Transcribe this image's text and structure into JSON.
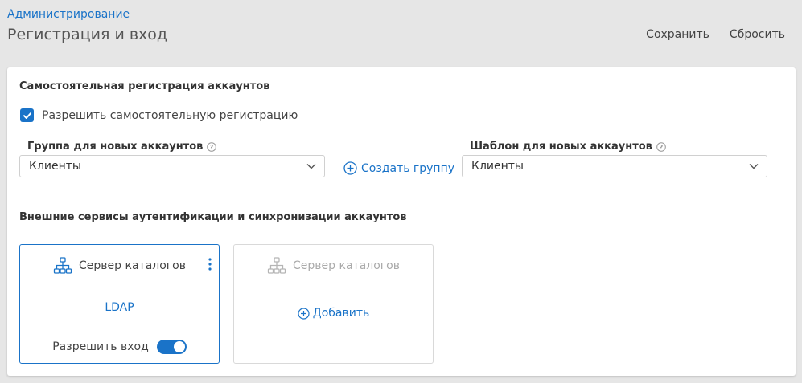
{
  "header": {
    "breadcrumb": "Администрирование",
    "title": "Регистрация и вход",
    "save_label": "Сохранить",
    "reset_label": "Сбросить"
  },
  "self_registration": {
    "section_title": "Самостоятельная регистрация аккаунтов",
    "allow_checkbox": {
      "label": "Разрешить самостоятельную регистрацию",
      "checked": true
    },
    "group": {
      "label": "Группа для новых аккаунтов",
      "value": "Клиенты"
    },
    "create_group_label": "Создать группу",
    "template": {
      "label": "Шаблон для новых аккаунтов",
      "value": "Клиенты"
    }
  },
  "external_services": {
    "section_title": "Внешние сервисы аутентификации и синхронизации аккаунтов",
    "services": [
      {
        "title": "Сервер каталогов",
        "type": "LDAP",
        "login_label": "Разрешить вход",
        "login_enabled": true
      }
    ],
    "placeholder": {
      "title": "Сервер каталогов",
      "add_label": "Добавить"
    }
  },
  "colors": {
    "accent": "#1a73c8",
    "background": "#e6e6e6",
    "card": "#ffffff",
    "muted": "#aaaaaa"
  },
  "icons": [
    "help-icon",
    "chevron-down-icon",
    "plus-circle-icon",
    "sitemap-icon",
    "kebab-icon",
    "checkmark-icon"
  ]
}
